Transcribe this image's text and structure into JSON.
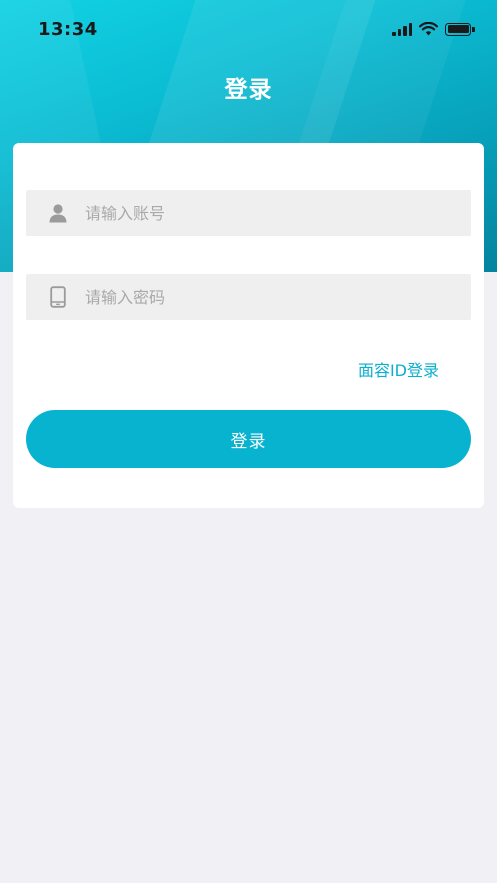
{
  "status_bar": {
    "time": "13:34"
  },
  "header": {
    "title": "登录"
  },
  "form": {
    "account_placeholder": "请输入账号",
    "password_placeholder": "请输入密码",
    "face_id_label": "面容ID登录",
    "login_label": "登录"
  },
  "icons": {
    "account": "user-icon",
    "password": "phone-icon"
  },
  "colors": {
    "accent": "#07b3cf",
    "link": "#0ab0cd",
    "background": "#f0f0f5",
    "field_background": "#efefef"
  }
}
